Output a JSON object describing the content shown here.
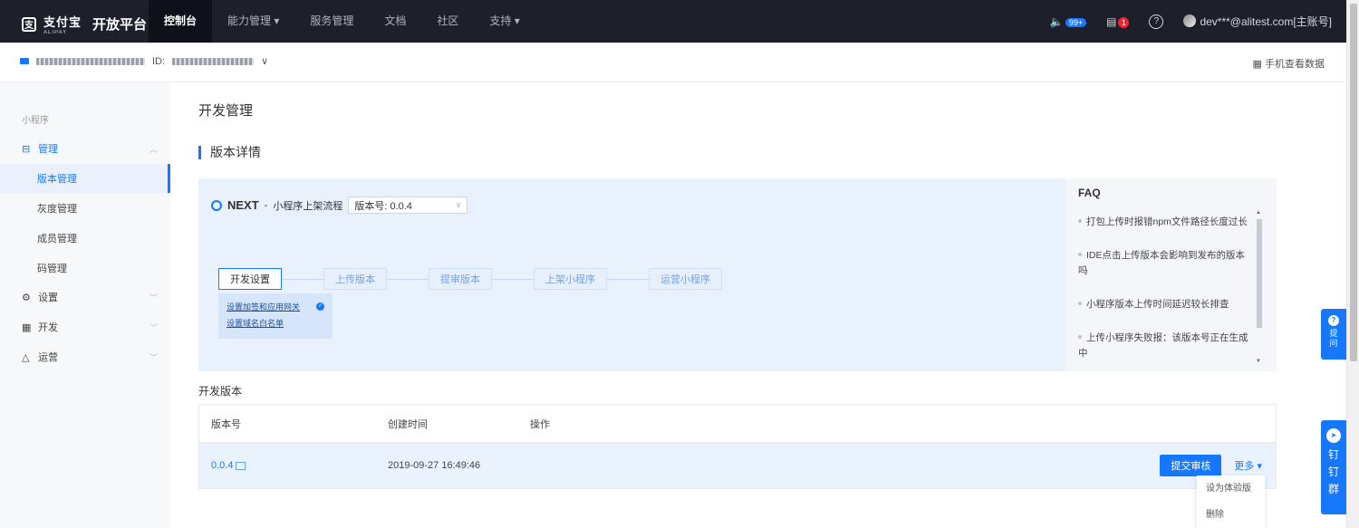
{
  "topbar": {
    "logo_zh": "支付宝",
    "logo_en": "ALIPAY",
    "platform": "开放平台",
    "nav": [
      {
        "label": "控制台"
      },
      {
        "label": "能力管理 ▾"
      },
      {
        "label": "服务管理"
      },
      {
        "label": "文档"
      },
      {
        "label": "社区"
      },
      {
        "label": "支持 ▾"
      }
    ],
    "notify_count": "99+",
    "tasks_count": "1",
    "user": "dev***@alitest.com[主账号]"
  },
  "appbar": {
    "id_label": "ID:",
    "mobile_view": "手机查看数据"
  },
  "sidebar": {
    "section": "小程序",
    "items": [
      {
        "label": "管理"
      },
      {
        "label": "版本管理"
      },
      {
        "label": "灰度管理"
      },
      {
        "label": "成员管理"
      },
      {
        "label": "码管理"
      },
      {
        "label": "设置"
      },
      {
        "label": "开发"
      },
      {
        "label": "运营"
      }
    ]
  },
  "main": {
    "page_title": "开发管理",
    "section_title": "版本详情",
    "flow": {
      "next_label": "NEXT",
      "dash": "-",
      "flow_name": "小程序上架流程",
      "version_select": "版本号: 0.0.4",
      "steps": [
        {
          "label": "开发设置"
        },
        {
          "label": "上传版本"
        },
        {
          "label": "提审版本"
        },
        {
          "label": "上架小程序"
        },
        {
          "label": "运营小程序"
        }
      ],
      "popup_links": [
        {
          "label": "设置加签和应用网关"
        },
        {
          "label": "设置域名白名单"
        }
      ]
    },
    "faq": {
      "title": "FAQ",
      "items": [
        {
          "label": "打包上传时报错npm文件路径长度过长"
        },
        {
          "label": "IDE点击上传版本会影响到发布的版本吗"
        },
        {
          "label": "小程序版本上传时间延迟较长排查"
        },
        {
          "label": "上传小程序失败报：该版本号正在生成中"
        }
      ]
    },
    "dev_versions": {
      "title": "开发版本",
      "headers": {
        "version": "版本号",
        "created": "创建时间",
        "ops": "操作"
      },
      "rows": [
        {
          "version": "0.0.4",
          "created": "2019-09-27 16:49:46",
          "submit": "提交审核",
          "more": "更多 ▾"
        }
      ]
    },
    "more_menu": [
      {
        "label": "设为体验版"
      },
      {
        "label": "删除"
      }
    ]
  },
  "floats": {
    "ask": "提问",
    "dingtalk": "钉钉群"
  }
}
